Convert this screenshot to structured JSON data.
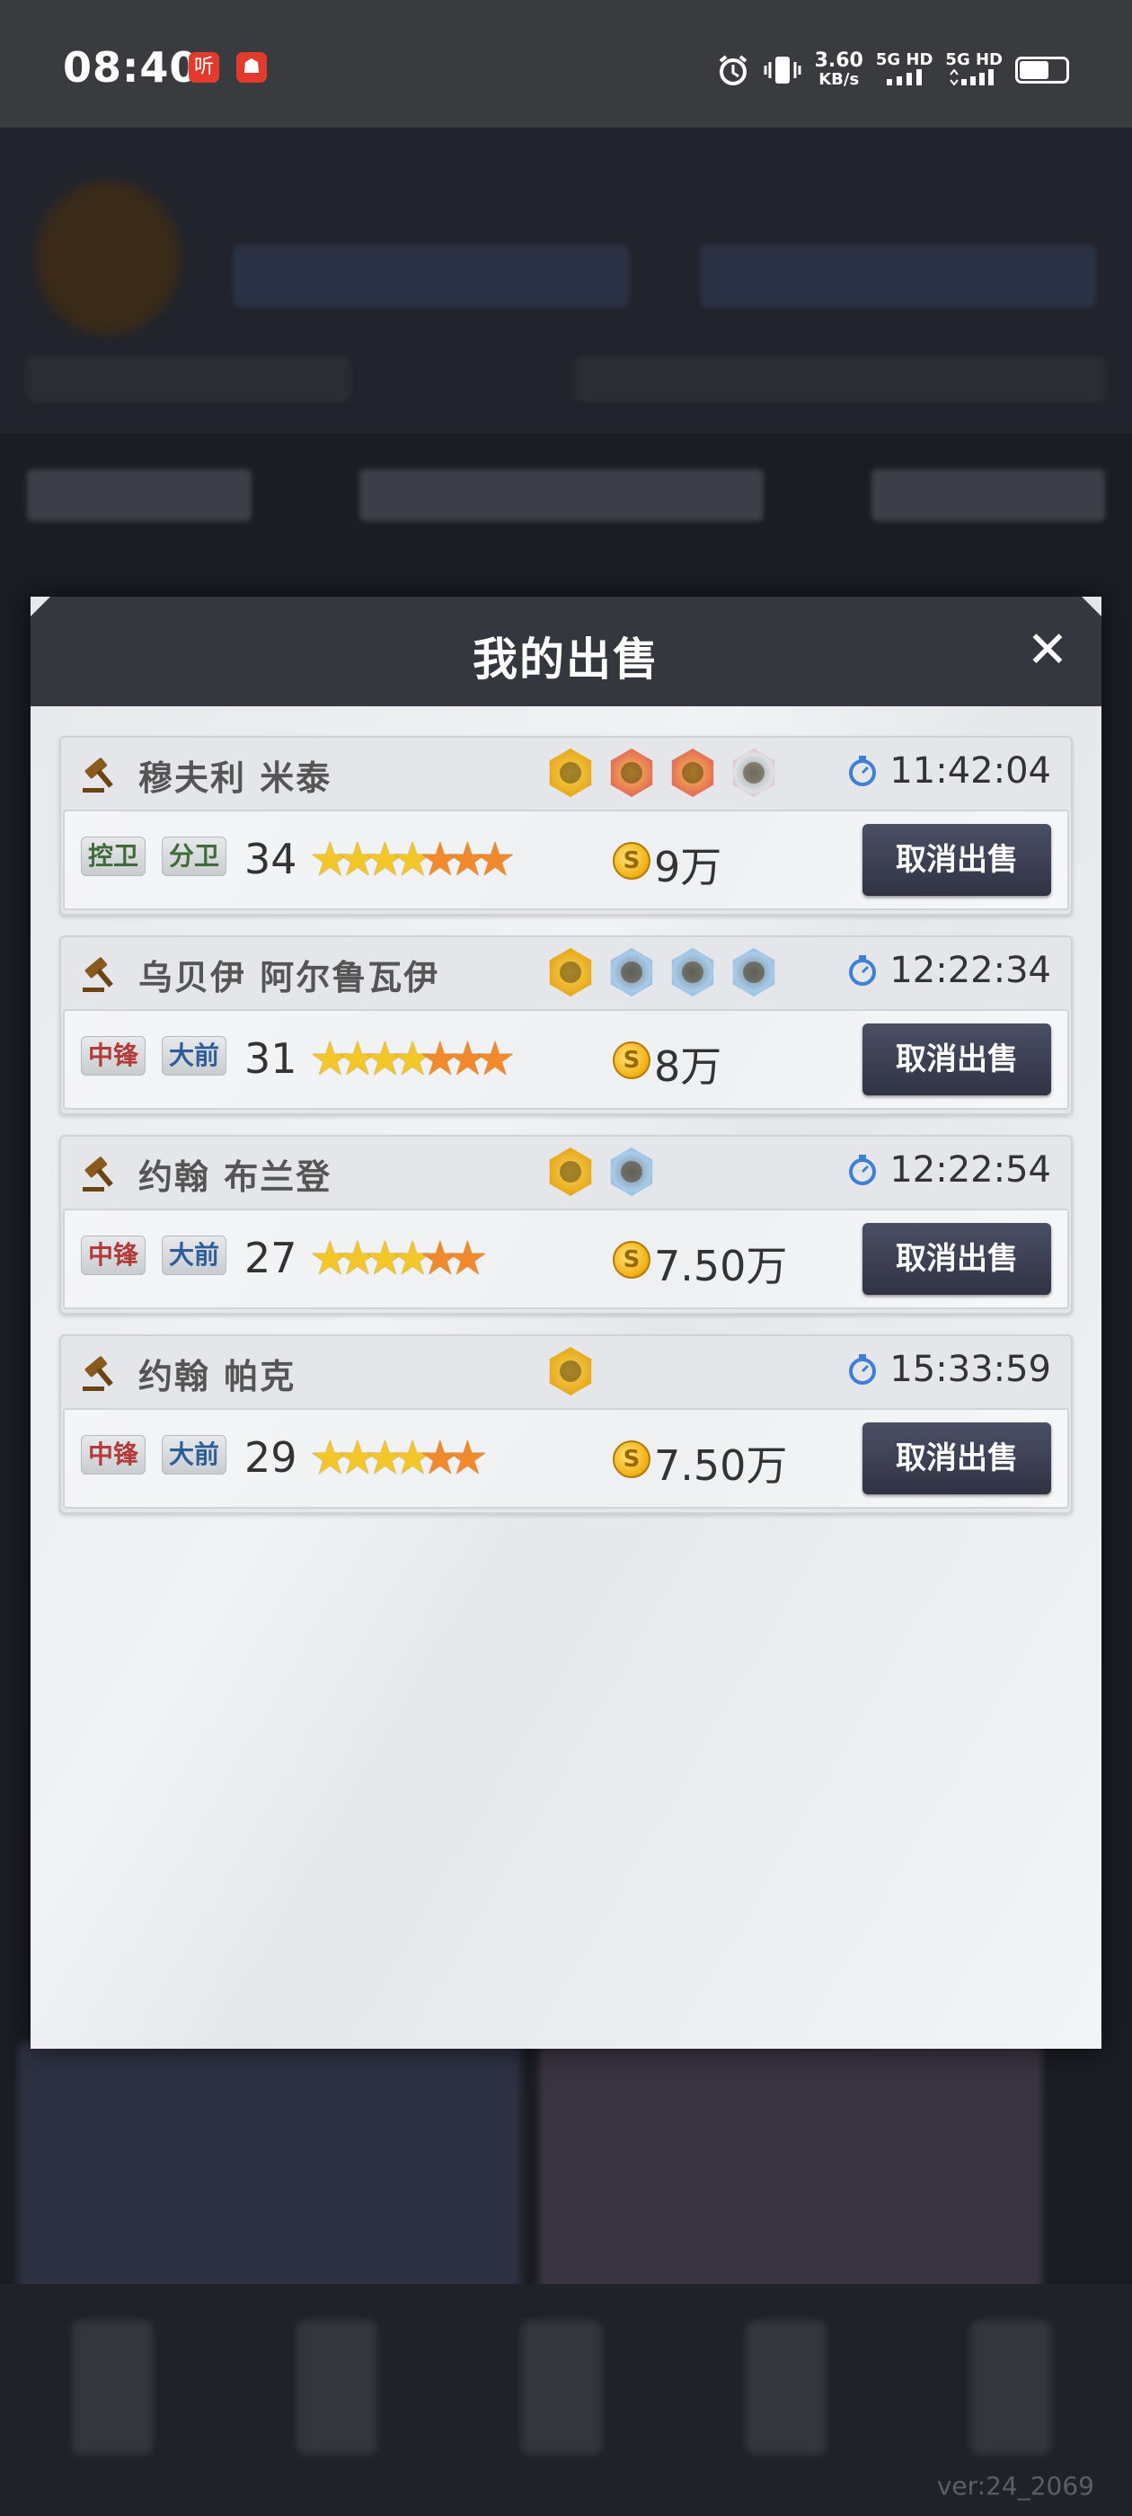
{
  "status_bar": {
    "time": "08:40",
    "app_icons": [
      "听",
      "☗"
    ],
    "net_speed_value": "3.60",
    "net_speed_unit": "KB/s",
    "sim1": "5G HD",
    "sim2": "5G HD"
  },
  "modal": {
    "title": "我的出售",
    "close_label": "✕",
    "listings": [
      {
        "name": "穆夫利 米泰",
        "badges": [
          "gold",
          "red",
          "red",
          "gray"
        ],
        "time": "11:42:04",
        "positions": [
          {
            "label": "控卫",
            "color": "green"
          },
          {
            "label": "分卫",
            "color": "green"
          }
        ],
        "rating": "34",
        "stars": {
          "gold": 4,
          "orange": 3
        },
        "price": "9万",
        "cancel_label": "取消出售"
      },
      {
        "name": "乌贝伊 阿尔鲁瓦伊",
        "badges": [
          "gold",
          "blue",
          "blue",
          "blue"
        ],
        "time": "12:22:34",
        "positions": [
          {
            "label": "中锋",
            "color": "red"
          },
          {
            "label": "大前",
            "color": "blue"
          }
        ],
        "rating": "31",
        "stars": {
          "gold": 4,
          "orange": 3
        },
        "price": "8万",
        "cancel_label": "取消出售"
      },
      {
        "name": "约翰 布兰登",
        "badges": [
          "gold",
          "blue"
        ],
        "time": "12:22:54",
        "positions": [
          {
            "label": "中锋",
            "color": "red"
          },
          {
            "label": "大前",
            "color": "blue"
          }
        ],
        "rating": "27",
        "stars": {
          "gold": 4,
          "orange": 2
        },
        "price": "7.50万",
        "cancel_label": "取消出售"
      },
      {
        "name": "约翰 帕克",
        "badges": [
          "gold"
        ],
        "time": "15:33:59",
        "positions": [
          {
            "label": "中锋",
            "color": "red"
          },
          {
            "label": "大前",
            "color": "blue"
          }
        ],
        "rating": "29",
        "stars": {
          "gold": 4,
          "orange": 2
        },
        "price": "7.50万",
        "cancel_label": "取消出售"
      }
    ]
  },
  "footer": {
    "version": "ver:24_2069"
  }
}
